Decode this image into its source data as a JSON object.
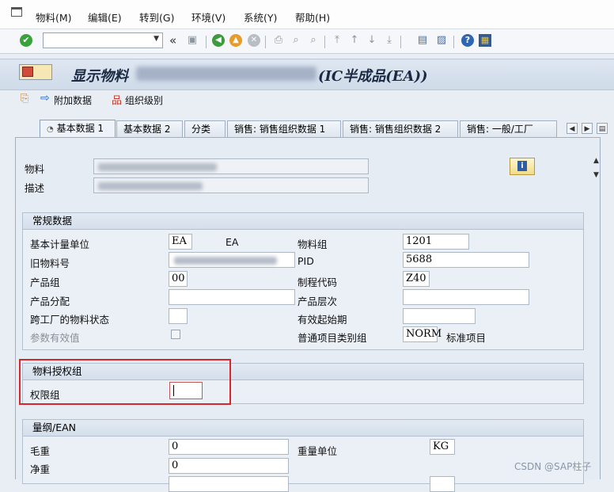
{
  "menu": [
    "物料(M)",
    "编辑(E)",
    "转到(G)",
    "环境(V)",
    "系统(Y)",
    "帮助(H)"
  ],
  "toolbar": {
    "command_value": "",
    "nav_symbol": "«"
  },
  "title": {
    "prefix": "显示物料",
    "suffix": "(IC半成品(EA))"
  },
  "app_toolbar": {
    "additional_data": "附加数据",
    "org_levels": "组织级别"
  },
  "tabs": [
    "基本数据 1",
    "基本数据 2",
    "分类",
    "销售: 销售组织数据 1",
    "销售: 销售组织数据 2",
    "销售: 一般/工厂"
  ],
  "header": {
    "material_label": "物料",
    "description_label": "描述"
  },
  "general": {
    "title": "常规数据",
    "base_uom_label": "基本计量单位",
    "base_uom_value": "EA",
    "base_uom_text": "EA",
    "old_material_label": "旧物料号",
    "division_label": "产品组",
    "division_value": "00",
    "product_alloc_label": "产品分配",
    "xplant_status_label": "跨工厂的物料状态",
    "assign_eff_label": "参数有效值",
    "matl_group_label": "物料组",
    "matl_group_value": "1201",
    "pid_label": "PID",
    "pid_value": "5688",
    "lab_office_label": "制程代码",
    "lab_office_value": "Z40",
    "prod_hier_label": "产品层次",
    "valid_from_label": "有效起始期",
    "item_cat_label": "普通项目类别组",
    "item_cat_value": "NORM",
    "item_cat_text": "标准项目"
  },
  "auth": {
    "title": "物料授权组",
    "auth_group_label": "权限组",
    "auth_group_value": ""
  },
  "dims": {
    "title": "量纲/EAN",
    "gross_label": "毛重",
    "gross_value": "0",
    "net_label": "净重",
    "net_value": "0",
    "weight_unit_label": "重量单位",
    "weight_unit_value": "KG"
  },
  "watermark": "CSDN @SAP柱子",
  "colors": {
    "highlight_border": "#d9262b",
    "title_text": "#1b2a44"
  }
}
